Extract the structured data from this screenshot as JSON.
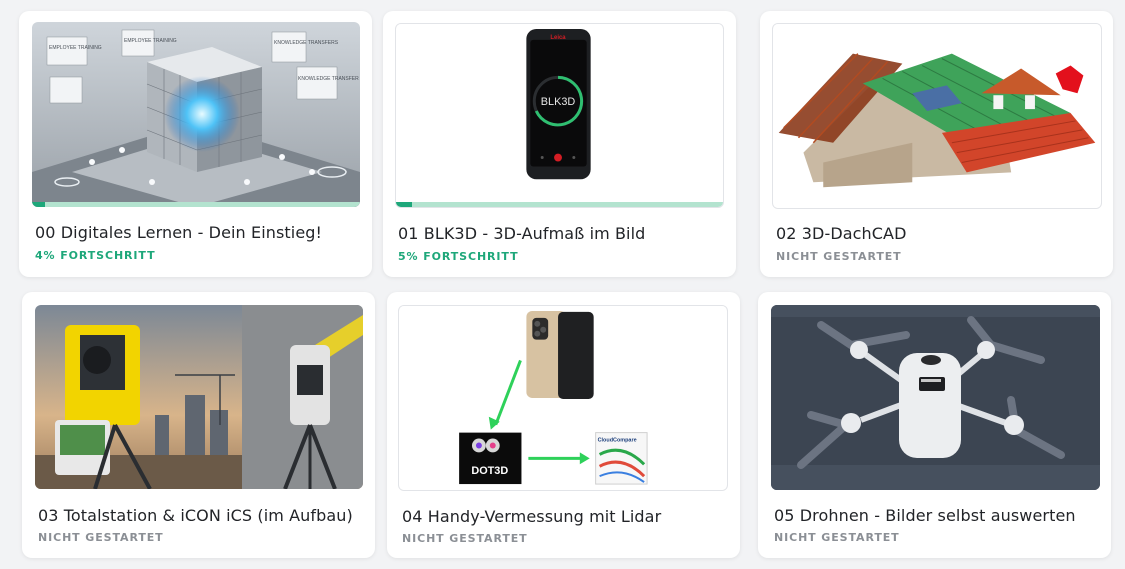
{
  "colors": {
    "accent": "#1ea77a",
    "progress_track": "#b3e3cf",
    "muted": "#8b8f95"
  },
  "courses": [
    {
      "title": "00 Digitales Lernen - Dein Einstieg!",
      "status": "4% FORTSCHRITT",
      "progress": 0.04,
      "image": {
        "type": "ai-cube-illustration",
        "labels": [
          "EMPLOYEE TRAINING",
          "EMPLOYEE TRAINING",
          "KNOWLEDGE TRANSFERS",
          "KNOWLEDGE TRANSFER"
        ]
      }
    },
    {
      "title": "01 BLK3D - 3D-Aufmaß im Bild",
      "status": "5% FORTSCHRITT",
      "progress": 0.05,
      "image": {
        "type": "leica-blk3d-device",
        "screen_text": "BLK3D"
      }
    },
    {
      "title": "02 3D-DachCAD",
      "status": "NICHT GESTARTET",
      "progress": null,
      "image": {
        "type": "roof-cad-render"
      }
    },
    {
      "title": "03 Totalstation & iCON iCS (im Aufbau)",
      "status": "NICHT GESTARTET",
      "progress": null,
      "image": {
        "type": "total-station-photo"
      }
    },
    {
      "title": "04 Handy-Vermessung mit Lidar",
      "status": "NICHT GESTARTET",
      "progress": null,
      "image": {
        "type": "lidar-workflow",
        "app1": "DOT3D",
        "app2": "CloudCompare"
      }
    },
    {
      "title": "05 Drohnen - Bilder selbst auswerten",
      "status": "NICHT GESTARTET",
      "progress": null,
      "image": {
        "type": "drone-photo"
      }
    }
  ]
}
